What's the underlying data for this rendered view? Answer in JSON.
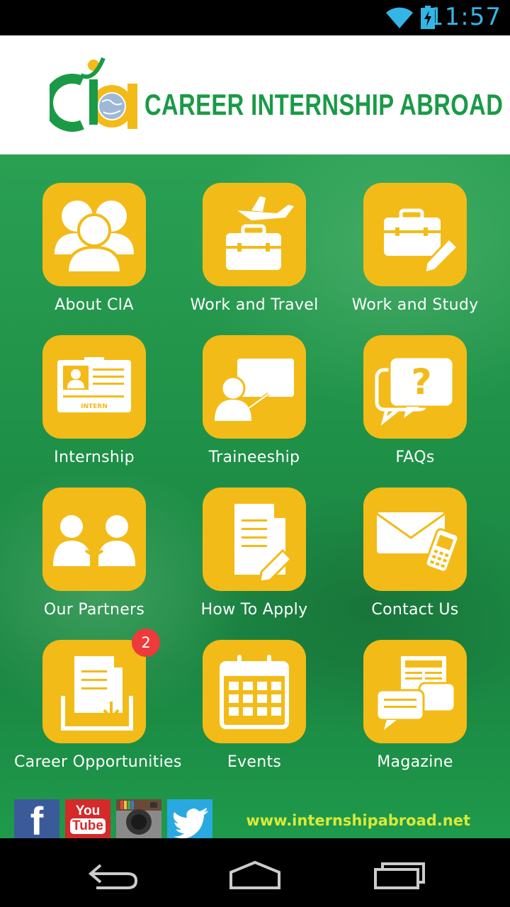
{
  "status_bar": {
    "time": "11:57"
  },
  "header": {
    "brand_text": "CAREER INTERNSHIP ABROAD",
    "logo_letters": "CIA"
  },
  "tiles": [
    {
      "label": "About CIA",
      "icon": "people-group-icon"
    },
    {
      "label": "Work and Travel",
      "icon": "airplane-briefcase-icon"
    },
    {
      "label": "Work and Study",
      "icon": "briefcase-pencil-icon"
    },
    {
      "label": "Internship",
      "icon": "id-card-icon",
      "icon_text": "INTERN"
    },
    {
      "label": "Traineeship",
      "icon": "presenter-board-icon"
    },
    {
      "label": "FAQs",
      "icon": "question-bubble-icon"
    },
    {
      "label": "Our Partners",
      "icon": "handshake-people-icon"
    },
    {
      "label": "How To Apply",
      "icon": "document-pencil-icon"
    },
    {
      "label": "Contact Us",
      "icon": "envelope-phone-icon"
    },
    {
      "label": "Career Opportunities",
      "icon": "document-tray-icon",
      "badge": "2"
    },
    {
      "label": "Events",
      "icon": "calendar-icon"
    },
    {
      "label": "Magazine",
      "icon": "chat-news-icon"
    }
  ],
  "social": {
    "facebook": "f",
    "youtube_top": "You",
    "youtube_bottom": "Tube"
  },
  "footer": {
    "website": "www.internshipabroad.net"
  },
  "colors": {
    "green": "#1e8f47",
    "tile": "#f3bb17",
    "badge": "#ee3a3a",
    "brand_green": "#1a9a46",
    "website": "#d9ea3a"
  }
}
